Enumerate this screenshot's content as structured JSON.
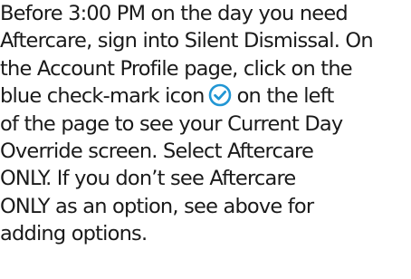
{
  "document": {
    "lines": [
      "Before 3:00 PM on the day you need",
      "Aftercare, sign into Silent Dismissal. On",
      "the Account Profile page, click on the",
      "blue check-mark icon",
      "on the left",
      "of the page to see your Current Day",
      "Override screen.  Select Aftercare",
      "ONLY.  If you don’t see Aftercare",
      "ONLY as an option, see above for",
      "adding options."
    ],
    "icon": {
      "name": "check-circle-icon",
      "color": "#2196d4"
    }
  }
}
